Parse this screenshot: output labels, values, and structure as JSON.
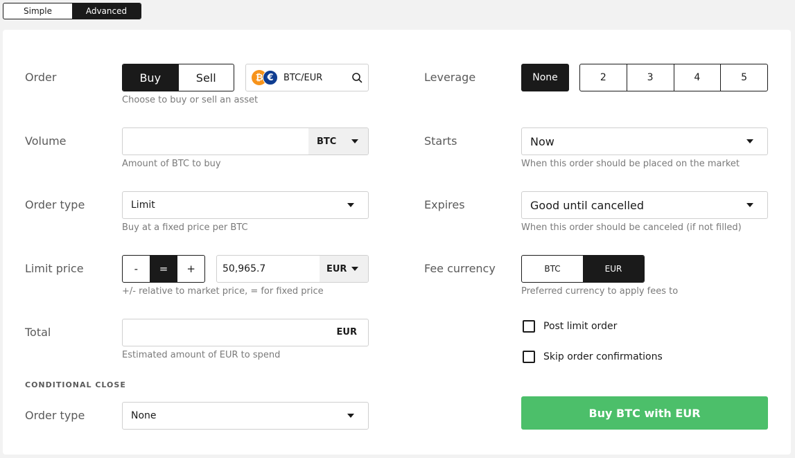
{
  "mode": {
    "simple": "Simple",
    "advanced": "Advanced",
    "selected": "Advanced"
  },
  "order": {
    "label": "Order",
    "buy": "Buy",
    "sell": "Sell",
    "pair": "BTC/EUR",
    "hint": "Choose to buy or sell an asset"
  },
  "volume": {
    "label": "Volume",
    "value": "",
    "unit": "BTC",
    "hint": "Amount of BTC to buy"
  },
  "order_type": {
    "label": "Order type",
    "value": "Limit",
    "hint": "Buy at a fixed price per BTC"
  },
  "limit_price": {
    "label": "Limit price",
    "minus": "-",
    "equals": "=",
    "plus": "+",
    "value": "50,965.7",
    "unit": "EUR",
    "hint": "+/- relative to market price, = for fixed price"
  },
  "total": {
    "label": "Total",
    "value": "",
    "unit": "EUR",
    "hint": "Estimated amount of EUR to spend"
  },
  "conditional_close": {
    "title": "CONDITIONAL CLOSE",
    "label": "Order type",
    "value": "None"
  },
  "leverage": {
    "label": "Leverage",
    "none": "None",
    "options": [
      "2",
      "3",
      "4",
      "5"
    ]
  },
  "starts": {
    "label": "Starts",
    "value": "Now",
    "hint": "When this order should be placed on the market"
  },
  "expires": {
    "label": "Expires",
    "value": "Good until cancelled",
    "hint": "When this order should be canceled (if not filled)"
  },
  "fee_currency": {
    "label": "Fee currency",
    "btc": "BTC",
    "eur": "EUR",
    "hint": "Preferred currency to apply fees to"
  },
  "checkboxes": {
    "post_limit": "Post limit order",
    "skip_confirm": "Skip order confirmations"
  },
  "submit": {
    "label": "Buy BTC with EUR"
  },
  "colors": {
    "accent": "#4cbf6a",
    "dark": "#1a1a1a",
    "btc": "#f7931a",
    "eur": "#0f3d91"
  }
}
